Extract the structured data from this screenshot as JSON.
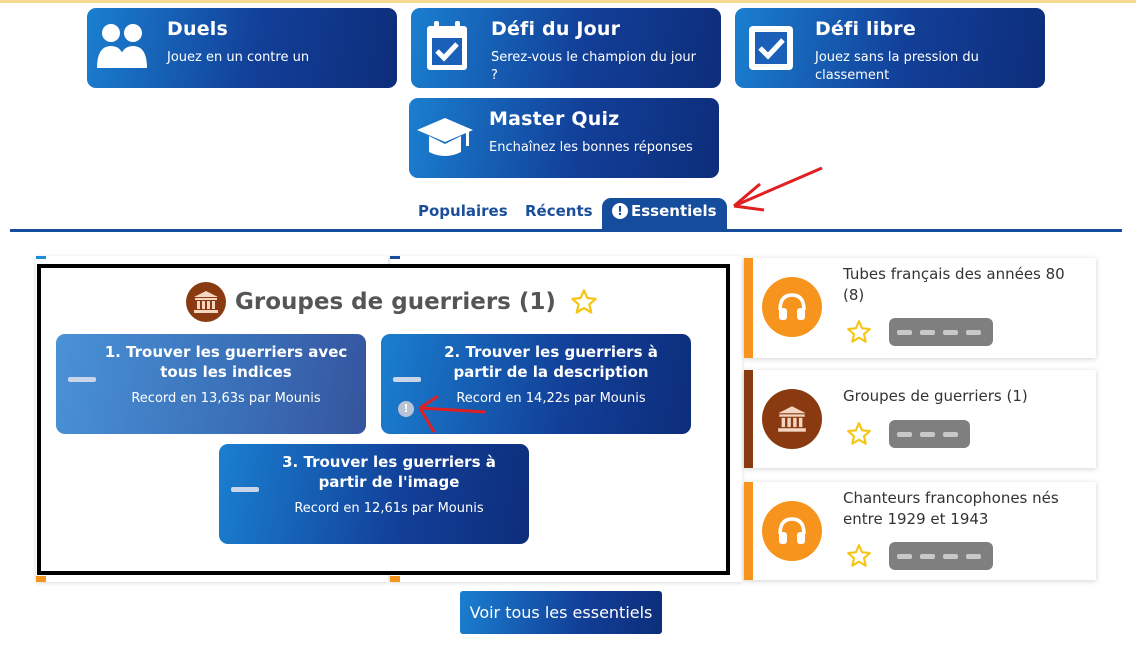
{
  "modes": [
    {
      "title": "Duels",
      "subtitle": "Jouez en un contre un",
      "icon": "users-icon"
    },
    {
      "title": "Défi du Jour",
      "subtitle": "Serez-vous le champion du jour ?",
      "icon": "calendar-check-icon"
    },
    {
      "title": "Défi libre",
      "subtitle": "Jouez sans la pression du classement",
      "icon": "checkbox-icon"
    },
    {
      "title": "Master Quiz",
      "subtitle": "Enchaînez les bonnes réponses",
      "icon": "graduation-cap-icon"
    }
  ],
  "tabs": [
    {
      "label": "Populaires"
    },
    {
      "label": "Récents"
    },
    {
      "label": "Essentiels",
      "active": true
    }
  ],
  "group": {
    "title": "Groupes de guerriers (1)",
    "icon": "museum-icon",
    "levels": [
      {
        "title": "1. Trouver les guerriers avec tous les indices",
        "record": "Record en 13,63s par Mounis"
      },
      {
        "title": "2. Trouver les guerriers à partir de la description",
        "record": "Record en 14,22s par Mounis"
      },
      {
        "title": "3. Trouver les guerriers à partir de l'image",
        "record": "Record en 12,61s par Mounis"
      }
    ]
  },
  "sidebar": {
    "items": [
      {
        "name": "Tubes français des années 80 (8)",
        "icon": "headphones-icon",
        "color": "#f7941d"
      },
      {
        "name": "Groupes de guerriers (1)",
        "icon": "museum-icon",
        "color": "#8a3a10"
      },
      {
        "name": "Chanteurs francophones nés entre 1929 et 1943",
        "icon": "headphones-icon",
        "color": "#f7941d"
      }
    ]
  },
  "see_all": "Voir tous les essentiels",
  "colors": {
    "brand": "#154c9b",
    "orange": "#f7941d",
    "brown": "#8a3a10",
    "star": "#f5c518"
  }
}
